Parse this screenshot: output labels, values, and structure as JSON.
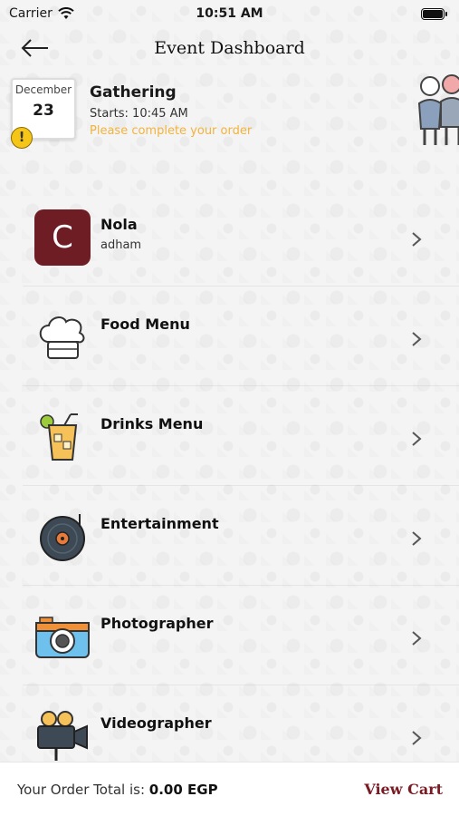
{
  "status_bar": {
    "carrier": "Carrier",
    "time": "10:51 AM"
  },
  "nav": {
    "title": "Event Dashboard"
  },
  "event": {
    "month": "December",
    "day": "23",
    "warning_mark": "!",
    "title": "Gathering",
    "starts": "Starts: 10:45 AM",
    "notice": "Please complete your order"
  },
  "items": [
    {
      "label": "Nola",
      "sub": "adham",
      "icon": "logo-c-icon",
      "logo_letter": "C"
    },
    {
      "label": "Food Menu",
      "icon": "chef-hat-icon"
    },
    {
      "label": "Drinks Menu",
      "icon": "drink-glass-icon"
    },
    {
      "label": "Entertainment",
      "icon": "vinyl-record-icon"
    },
    {
      "label": "Photographer",
      "icon": "camera-icon"
    },
    {
      "label": "Videographer",
      "icon": "video-camera-icon"
    }
  ],
  "footer": {
    "total_label": "Your Order Total is:",
    "total_value": "0.00 EGP",
    "view_cart": "View Cart"
  },
  "colors": {
    "accent": "#7a1b24",
    "warning": "#f2b33d",
    "logo_bg": "#6f1d24"
  }
}
